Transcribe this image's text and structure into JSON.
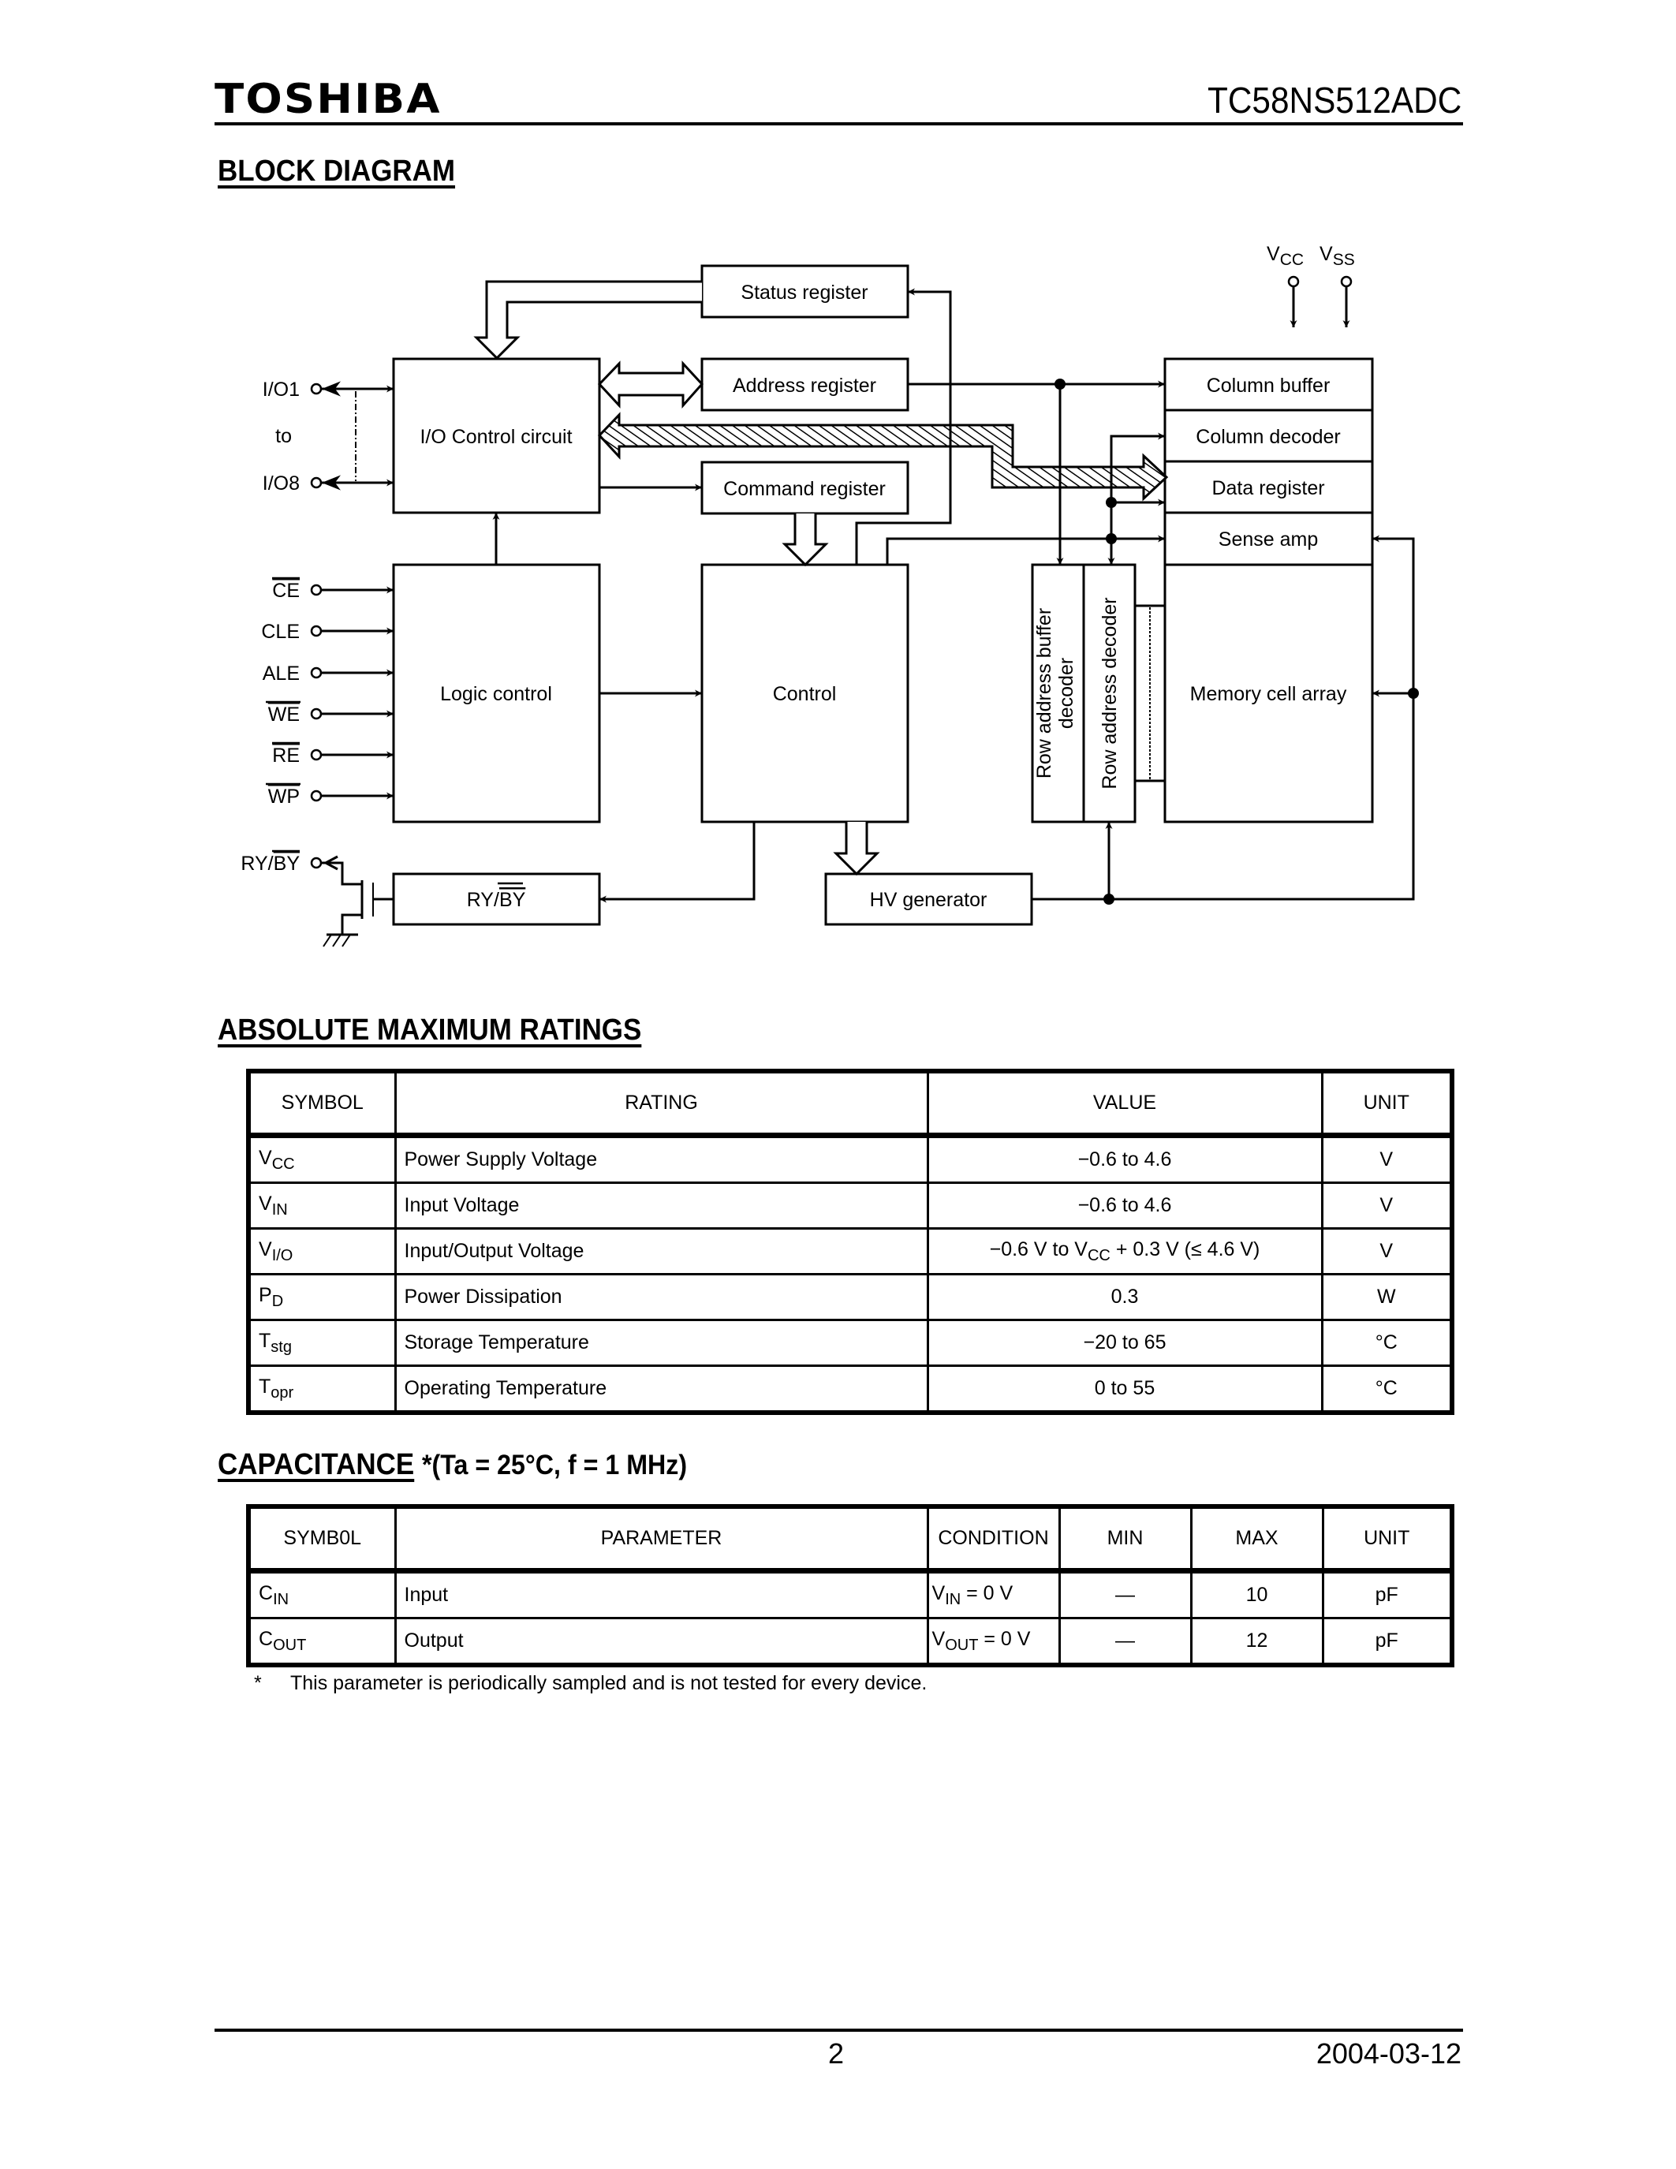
{
  "header": {
    "brand": "TOSHIBA",
    "part_number": "TC58NS512ADC"
  },
  "block_diagram": {
    "title": "BLOCK DIAGRAM",
    "blocks": {
      "status_register": "Status register",
      "address_register": "Address register",
      "command_register": "Command register",
      "io_control": "I/O Control circuit",
      "logic_control": "Logic control",
      "control": "Control",
      "ry_by_main": "RY/",
      "ry_by_bar": "BY",
      "hv_generator": "HV generator",
      "column_buffer": "Column buffer",
      "column_decoder": "Column decoder",
      "data_register": "Data register",
      "sense_amp": "Sense amp",
      "memory_cell_array": "Memory cell array",
      "row_address_buffer_line1": "Row address buffer",
      "row_address_buffer_line2": "decoder",
      "row_address_decoder": "Row address decoder"
    },
    "pins": {
      "io1": "I/O1",
      "io_to": "to",
      "io8": "I/O8",
      "ce": "CE",
      "cle": "CLE",
      "ale": "ALE",
      "we": "WE",
      "re": "RE",
      "wp": "WP",
      "ry_by_prefix": "RY/",
      "ry_by_bar": "BY",
      "vcc_main": "V",
      "vcc_sub": "CC",
      "vss_main": "V",
      "vss_sub": "SS"
    }
  },
  "absolute_maximum_ratings": {
    "title": "ABSOLUTE MAXIMUM RATINGS",
    "headers": [
      "SYMBOL",
      "RATING",
      "VALUE",
      "UNIT"
    ],
    "rows": [
      {
        "symbol": "V",
        "symbol_sub": "CC",
        "rating": "Power Supply Voltage",
        "value": "−0.6 to 4.6",
        "unit": "V"
      },
      {
        "symbol": "V",
        "symbol_sub": "IN",
        "rating": "Input Voltage",
        "value": "−0.6 to 4.6",
        "unit": "V"
      },
      {
        "symbol": "V",
        "symbol_sub": "I/O",
        "rating": "Input/Output Voltage",
        "value_pre": "−0.6 V to V",
        "value_sub": "CC",
        "value_post": " + 0.3 V (≤ 4.6 V)",
        "unit": "V"
      },
      {
        "symbol": "P",
        "symbol_sub": "D",
        "rating": "Power Dissipation",
        "value": "0.3",
        "unit": "W"
      },
      {
        "symbol": "T",
        "symbol_sub": "stg",
        "rating": "Storage Temperature",
        "value": "−20 to 65",
        "unit": "°C"
      },
      {
        "symbol": "T",
        "symbol_sub": "opr",
        "rating": "Operating Temperature",
        "value": "0 to 55",
        "unit": "°C"
      }
    ]
  },
  "capacitance": {
    "title": "CAPACITANCE",
    "conditions": "*(Ta = 25°C, f = 1 MHz)",
    "headers": [
      "SYMB0L",
      "PARAMETER",
      "CONDITION",
      "MIN",
      "MAX",
      "UNIT"
    ],
    "rows": [
      {
        "symbol": "C",
        "symbol_sub": "IN",
        "parameter": "Input",
        "cond_main": "V",
        "cond_sub": "IN",
        "cond_rest": " = 0 V",
        "min": "—",
        "max": "10",
        "unit": "pF"
      },
      {
        "symbol": "C",
        "symbol_sub": "OUT",
        "parameter": "Output",
        "cond_main": "V",
        "cond_sub": "OUT",
        "cond_rest": " = 0 V",
        "min": "—",
        "max": "12",
        "unit": "pF"
      }
    ],
    "footnote_mark": "*",
    "footnote": "This parameter is periodically sampled and is not tested for every device."
  },
  "footer": {
    "page_number": "2",
    "date": "2004-03-12"
  }
}
